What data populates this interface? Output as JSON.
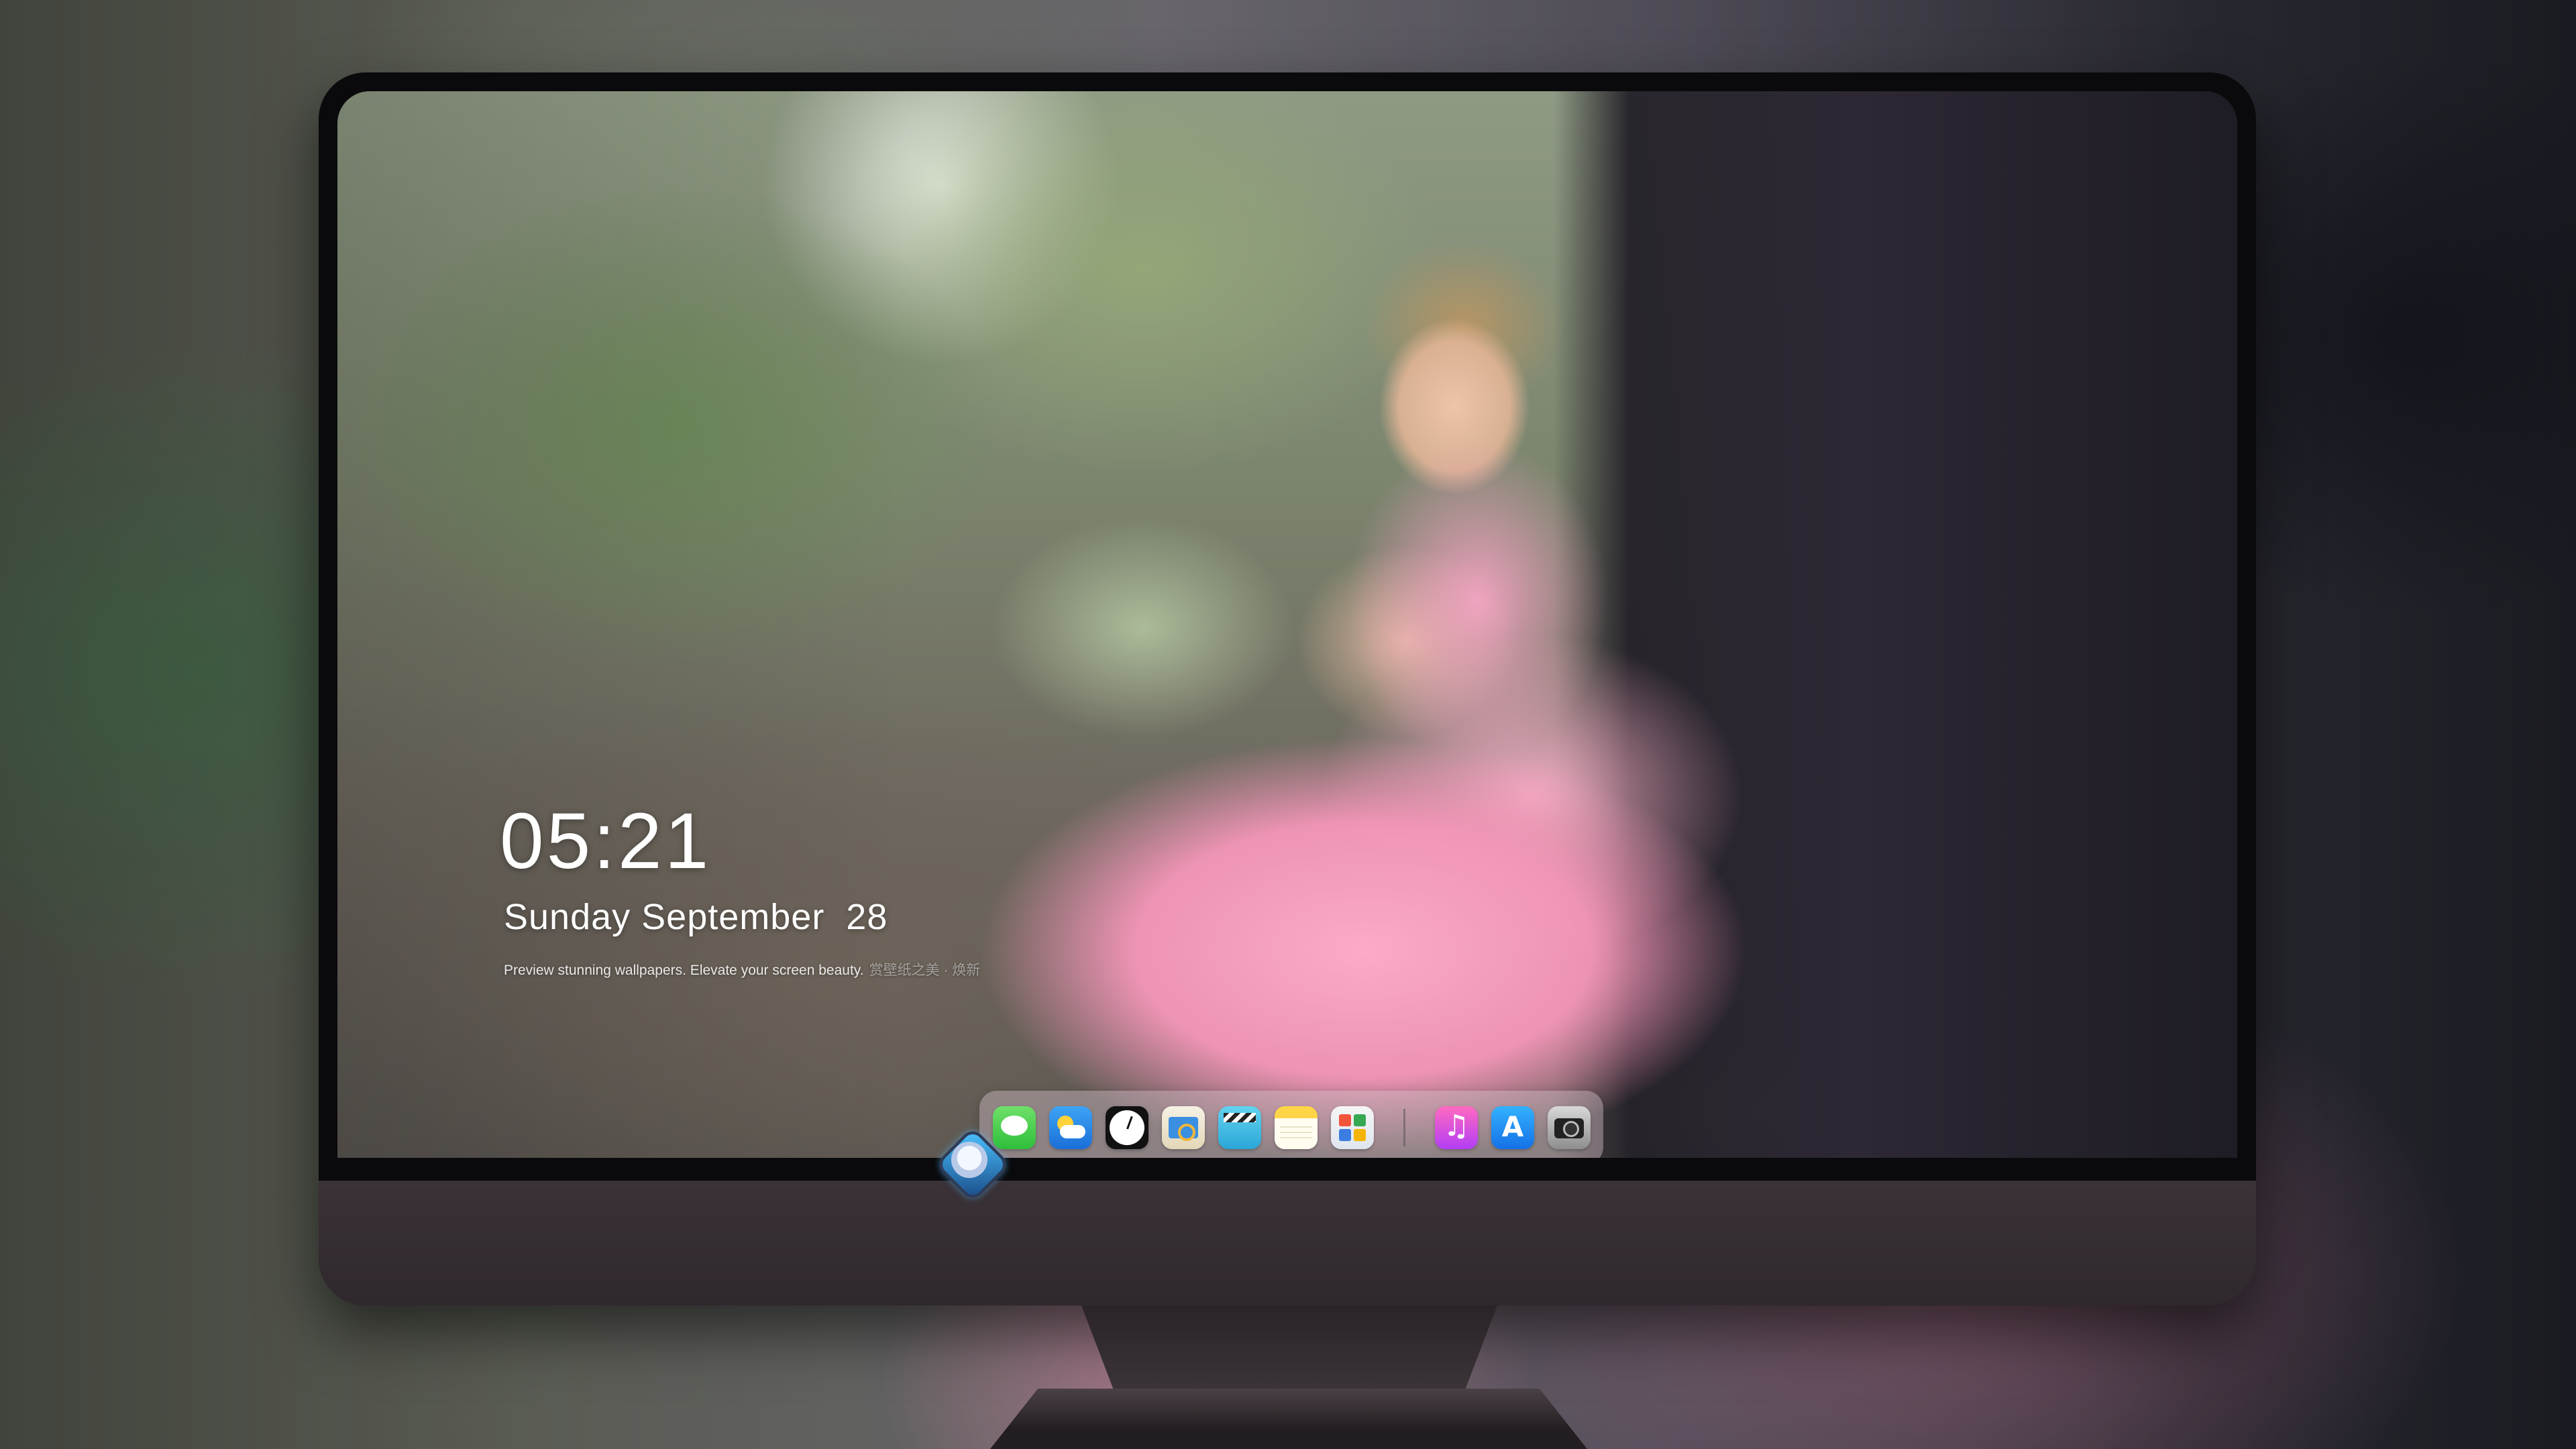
{
  "lockscreen": {
    "time": "05:21",
    "date": "Sunday September  28",
    "caption": "Preview stunning wallpapers. Elevate your screen beauty.",
    "caption_faded": "赏壁纸之美 · 焕新"
  },
  "dock": {
    "apps": [
      {
        "name": "Messages",
        "icon": "messages-icon"
      },
      {
        "name": "Weather",
        "icon": "weather-icon"
      },
      {
        "name": "Clock",
        "icon": "clock-icon"
      },
      {
        "name": "Preview",
        "icon": "preview-icon"
      },
      {
        "name": "Clips",
        "icon": "clips-icon"
      },
      {
        "name": "Notes",
        "icon": "notes-icon"
      },
      {
        "name": "Photos",
        "icon": "photos-icon"
      },
      {
        "name": "Music",
        "icon": "music-icon"
      },
      {
        "name": "App Store",
        "icon": "app-store-icon"
      },
      {
        "name": "Camera",
        "icon": "camera-icon"
      }
    ]
  },
  "colors": {
    "dress_pink": "#f5a3c0",
    "monitor_chin": "#352e33",
    "text": "#ffffff"
  }
}
